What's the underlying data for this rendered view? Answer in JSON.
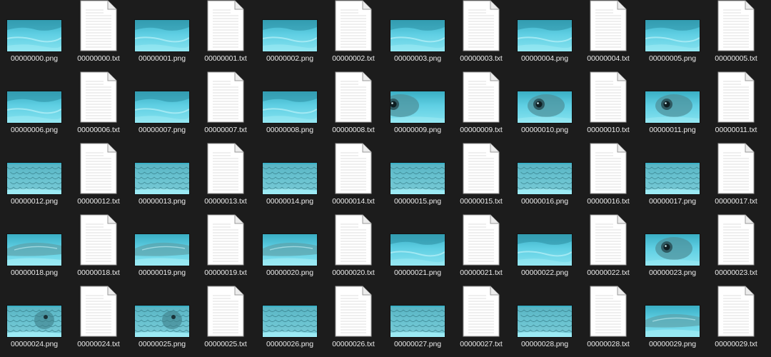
{
  "explorer": {
    "background_color": "#1c1c1c",
    "label_color": "#e9e9e9",
    "files": [
      {
        "name": "00000000.png",
        "type": "png",
        "preview": "water"
      },
      {
        "name": "00000000.txt",
        "type": "txt"
      },
      {
        "name": "00000001.png",
        "type": "png",
        "preview": "water"
      },
      {
        "name": "00000001.txt",
        "type": "txt"
      },
      {
        "name": "00000002.png",
        "type": "png",
        "preview": "water"
      },
      {
        "name": "00000002.txt",
        "type": "txt"
      },
      {
        "name": "00000003.png",
        "type": "png",
        "preview": "water"
      },
      {
        "name": "00000003.txt",
        "type": "txt"
      },
      {
        "name": "00000004.png",
        "type": "png",
        "preview": "water"
      },
      {
        "name": "00000004.txt",
        "type": "txt"
      },
      {
        "name": "00000005.png",
        "type": "png",
        "preview": "water"
      },
      {
        "name": "00000005.txt",
        "type": "txt"
      },
      {
        "name": "00000006.png",
        "type": "png",
        "preview": "water"
      },
      {
        "name": "00000006.txt",
        "type": "txt"
      },
      {
        "name": "00000007.png",
        "type": "png",
        "preview": "water"
      },
      {
        "name": "00000007.txt",
        "type": "txt"
      },
      {
        "name": "00000008.png",
        "type": "png",
        "preview": "water"
      },
      {
        "name": "00000008.txt",
        "type": "txt"
      },
      {
        "name": "00000009.png",
        "type": "png",
        "preview": "fish-eye-edge"
      },
      {
        "name": "00000009.txt",
        "type": "txt"
      },
      {
        "name": "00000010.png",
        "type": "png",
        "preview": "fish-eye"
      },
      {
        "name": "00000010.txt",
        "type": "txt"
      },
      {
        "name": "00000011.png",
        "type": "png",
        "preview": "fish-eye"
      },
      {
        "name": "00000011.txt",
        "type": "txt"
      },
      {
        "name": "00000012.png",
        "type": "png",
        "preview": "fish-scales"
      },
      {
        "name": "00000012.txt",
        "type": "txt"
      },
      {
        "name": "00000013.png",
        "type": "png",
        "preview": "fish-scales"
      },
      {
        "name": "00000013.txt",
        "type": "txt"
      },
      {
        "name": "00000014.png",
        "type": "png",
        "preview": "fish-scales"
      },
      {
        "name": "00000014.txt",
        "type": "txt"
      },
      {
        "name": "00000015.png",
        "type": "png",
        "preview": "fish-scales"
      },
      {
        "name": "00000015.txt",
        "type": "txt"
      },
      {
        "name": "00000016.png",
        "type": "png",
        "preview": "fish-scales"
      },
      {
        "name": "00000016.txt",
        "type": "txt"
      },
      {
        "name": "00000017.png",
        "type": "png",
        "preview": "fish-scales"
      },
      {
        "name": "00000017.txt",
        "type": "txt"
      },
      {
        "name": "00000018.png",
        "type": "png",
        "preview": "fish-body"
      },
      {
        "name": "00000018.txt",
        "type": "txt"
      },
      {
        "name": "00000019.png",
        "type": "png",
        "preview": "fish-body"
      },
      {
        "name": "00000019.txt",
        "type": "txt"
      },
      {
        "name": "00000020.png",
        "type": "png",
        "preview": "fish-body"
      },
      {
        "name": "00000020.txt",
        "type": "txt"
      },
      {
        "name": "00000021.png",
        "type": "png",
        "preview": "water"
      },
      {
        "name": "00000021.txt",
        "type": "txt"
      },
      {
        "name": "00000022.png",
        "type": "png",
        "preview": "water"
      },
      {
        "name": "00000022.txt",
        "type": "txt"
      },
      {
        "name": "00000023.png",
        "type": "png",
        "preview": "fish-eye"
      },
      {
        "name": "00000023.txt",
        "type": "txt"
      },
      {
        "name": "00000024.png",
        "type": "png",
        "preview": "fish-head"
      },
      {
        "name": "00000024.txt",
        "type": "txt"
      },
      {
        "name": "00000025.png",
        "type": "png",
        "preview": "fish-head"
      },
      {
        "name": "00000025.txt",
        "type": "txt"
      },
      {
        "name": "00000026.png",
        "type": "png",
        "preview": "fish-scales"
      },
      {
        "name": "00000026.txt",
        "type": "txt"
      },
      {
        "name": "00000027.png",
        "type": "png",
        "preview": "fish-scales"
      },
      {
        "name": "00000027.txt",
        "type": "txt"
      },
      {
        "name": "00000028.png",
        "type": "png",
        "preview": "fish-scales"
      },
      {
        "name": "00000028.txt",
        "type": "txt"
      },
      {
        "name": "00000029.png",
        "type": "png",
        "preview": "fish-body"
      },
      {
        "name": "00000029.txt",
        "type": "txt"
      }
    ]
  }
}
